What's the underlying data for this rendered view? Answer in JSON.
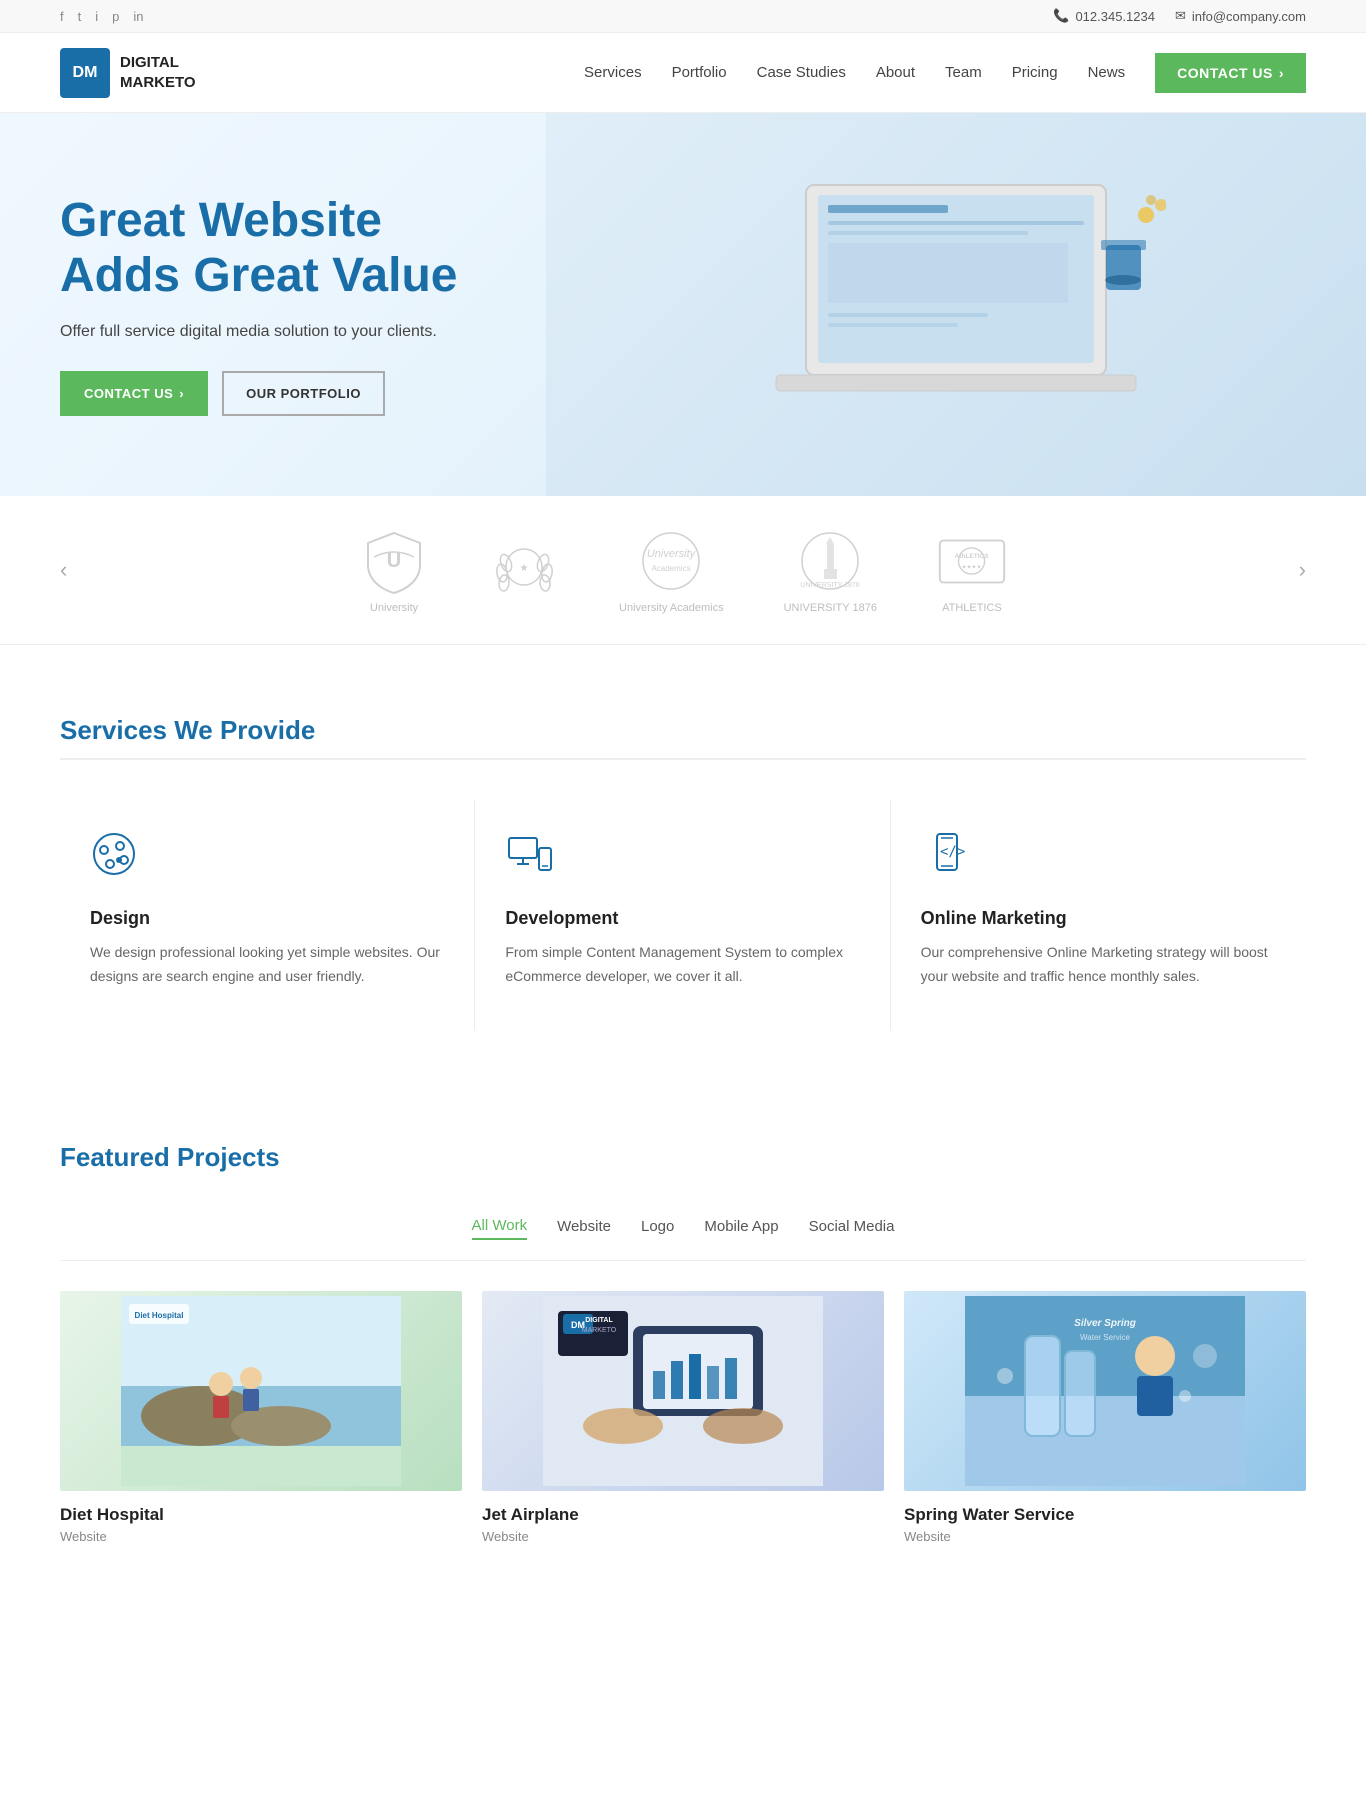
{
  "topbar": {
    "phone": "012.345.1234",
    "email": "info@company.com",
    "social": [
      "f",
      "t",
      "i",
      "p",
      "in"
    ]
  },
  "navbar": {
    "logo_abbr": "DM",
    "logo_line1": "DIGITAL",
    "logo_line2": "MARKETO",
    "links": [
      "Services",
      "Portfolio",
      "Case Studies",
      "About",
      "Team",
      "Pricing",
      "News"
    ],
    "cta_label": "CONTACT US"
  },
  "hero": {
    "title_line1": "Great Website",
    "title_line2": "Adds Great Value",
    "subtitle": "Offer full service digital media solution to your clients.",
    "btn_primary": "CONTACT US",
    "btn_outline": "OUR PORTFOLIO"
  },
  "logos": {
    "items": [
      {
        "label": "University"
      },
      {
        "label": ""
      },
      {
        "label": "University Academics"
      },
      {
        "label": "UNIVERSITY 1876"
      },
      {
        "label": "ATHLETICS"
      }
    ]
  },
  "services": {
    "section_title": "Services We Provide",
    "items": [
      {
        "name": "Design",
        "desc": "We design professional looking yet simple websites. Our designs are search engine and user friendly.",
        "icon": "palette"
      },
      {
        "name": "Development",
        "desc": "From simple Content Management System to complex eCommerce developer, we cover it all.",
        "icon": "devices"
      },
      {
        "name": "Online Marketing",
        "desc": "Our comprehensive Online Marketing strategy will boost your website and traffic hence monthly sales.",
        "icon": "mobile-code"
      }
    ]
  },
  "projects": {
    "section_title": "Featured Projects",
    "filters": [
      "All Work",
      "Website",
      "Logo",
      "Mobile App",
      "Social Media"
    ],
    "active_filter": "All Work",
    "items": [
      {
        "title": "Diet Hospital",
        "type": "Website",
        "thumb_color": "thumb-1"
      },
      {
        "title": "Jet Airplane",
        "type": "Website",
        "thumb_color": "thumb-2"
      },
      {
        "title": "Spring Water Service",
        "type": "Website",
        "thumb_color": "thumb-3"
      }
    ]
  }
}
